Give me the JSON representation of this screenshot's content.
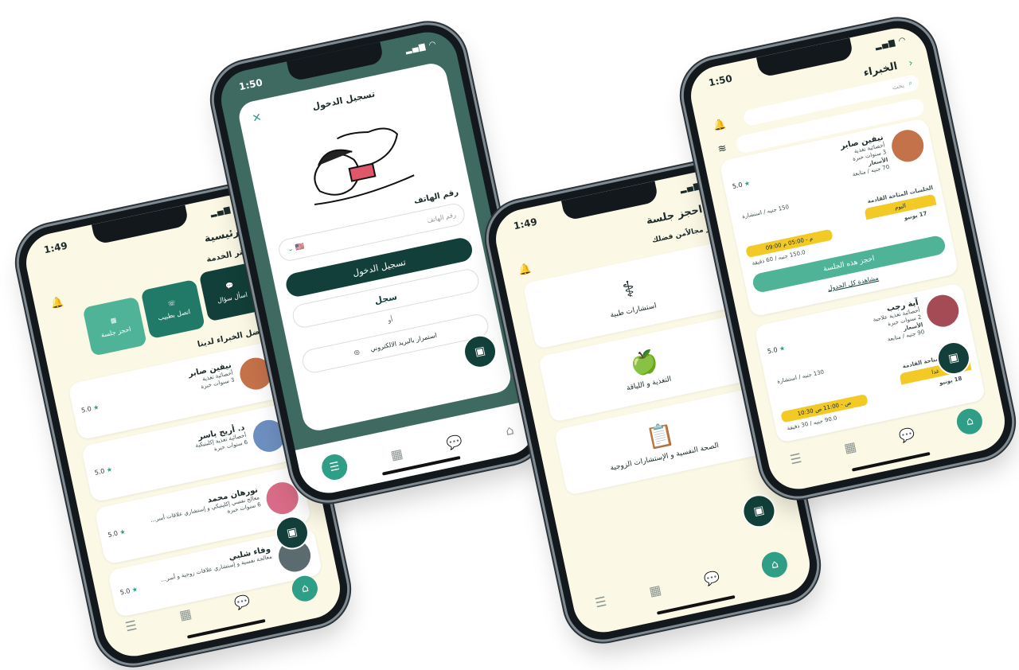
{
  "status": {
    "time": "1:49",
    "time2": "1:50",
    "signal": "▂▄▆ ◠ ▭"
  },
  "phone1": {
    "title": "الرئيسية",
    "choose_service": "اختر الخدمة",
    "services": [
      "اسأل سؤال",
      "اتصل بطبيب",
      "احجز جلسة"
    ],
    "best_experts": "أفضل الخبراء لدينا",
    "experts": [
      {
        "name": "نيفين صابر",
        "line1": "أخصائية تغذية",
        "line2": "3 سنوات خبرة",
        "rating": "5.0",
        "avatar_color": "#c4724a"
      },
      {
        "name": "د. أريج ياسر",
        "line1": "أخصائية تغذية إكلينيكية",
        "line2": "6 سنوات خبرة",
        "rating": "5.0",
        "avatar_color": "#6d8fbf"
      },
      {
        "name": "نورهان محمد",
        "line1": "معالج نفسي إكلينيكي و إستشاري علاقات أسر...",
        "line2": "6 سنوات خبرة",
        "rating": "5.0",
        "avatar_color": "#d86b86"
      },
      {
        "name": "وفاء شلبي",
        "line1": "معالجة نفسية و إستشاري علاقات زوجية و أسر...",
        "line2": "",
        "rating": "5.0",
        "avatar_color": "#5c6b70"
      }
    ]
  },
  "phone2": {
    "title": "تسجيل الدخول",
    "phone_label": "رقم الهاتف",
    "phone_placeholder": "رقم الهاتف",
    "flag": "🇺🇸",
    "login_button": "تسجيل الدخول",
    "register_button": "سجل",
    "or": "أو",
    "email_button": "استمرار بالبريد الالكتروني"
  },
  "phone3": {
    "title": "احجز جلسة",
    "subtitle": "اختر مجالاًمن فضلك",
    "domains": [
      "استشارات طبية",
      "التغذية و اللياقة",
      "الصحة النفسية و الإستشارات الزوجية"
    ]
  },
  "phone4": {
    "title": "الخبراء",
    "search_placeholder": "بحث",
    "experts": [
      {
        "name": "نيفين صابر",
        "line1": "أخصائية تغذية",
        "line2": "3 سنوات خبرة",
        "price_label": "الأسعار",
        "price1": "70 جنيه / متابعة",
        "price2": "150 جنيه / استشارة",
        "rating": "5.0",
        "sessions_label": "الجلسات المتاحة القادمة",
        "day_label": "اليوم",
        "date": "17 يونيو",
        "slot": "09:00 م - 05:00 م",
        "slot_price": "150.0 جنيه / 60 دقيقة",
        "book": "احجز هذه الجلسة",
        "view_all": "مشاهدة كل الجدول",
        "avatar_color": "#c4724a"
      },
      {
        "name": "آية رجب",
        "line1": "أخصائية تغذية علاجية",
        "line2": "2 سنوات خبرة",
        "price_label": "الأسعار",
        "price1": "90 جنيه / متابعة",
        "price2": "130 جنيه / استشارة",
        "rating": "5.0",
        "sessions_label": "الجلسات المتاحة القادمة",
        "day_label": "غدا",
        "date": "18 يونيو",
        "slot": "10:30 ص - 11:00 ص",
        "slot_price": "90.0 جنيه / 30 دقيقة",
        "avatar_color": "#a44b55"
      }
    ]
  },
  "colors": {
    "primary_dark": "#123f39",
    "primary": "#2f9e86",
    "cream": "#fbf8e6",
    "yellow": "#f2c925"
  },
  "icons": [
    "bell-icon",
    "chat-icon",
    "phone-icon",
    "calendar-icon",
    "home-icon",
    "menu-icon",
    "search-icon",
    "stethoscope-icon",
    "apple-icon",
    "clipboard-icon",
    "filter-icon",
    "close-icon",
    "star-icon"
  ]
}
